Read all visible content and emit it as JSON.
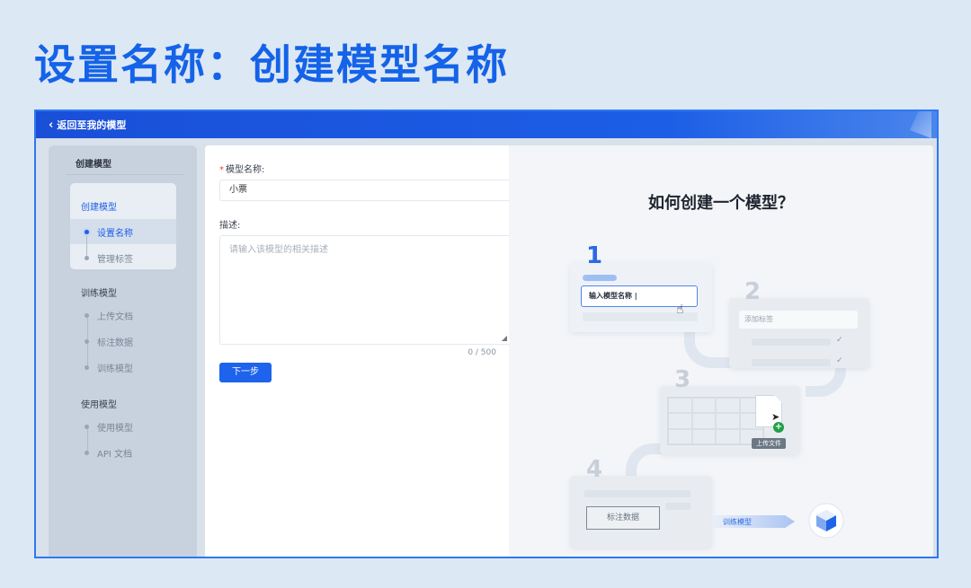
{
  "slide_title": "设置名称：创建模型名称",
  "topbar": {
    "back_label": "返回至我的模型"
  },
  "sidebar": {
    "header": "创建模型",
    "create_group": {
      "title": "创建模型",
      "items": [
        "设置名称",
        "管理标签"
      ]
    },
    "train_group": {
      "title": "训练模型",
      "items": [
        "上传文档",
        "标注数据",
        "训练模型"
      ]
    },
    "use_group": {
      "title": "使用模型",
      "items": [
        "使用模型",
        "API 文档"
      ]
    }
  },
  "form": {
    "required_mark": "*",
    "name_label": "模型名称:",
    "name_value": "小票",
    "desc_label": "描述:",
    "desc_placeholder": "请输入该模型的相关描述",
    "counter": "0 / 500",
    "next_button": "下一步"
  },
  "illustration": {
    "title": "如何创建一个模型？",
    "step_numbers": [
      "1",
      "2",
      "3",
      "4"
    ],
    "step1_input": "输入模型名称 |",
    "step2_input": "添加标签",
    "step3_upload": "上传文件",
    "step4_annotate": "标注数据",
    "train_label": "训练模型"
  }
}
